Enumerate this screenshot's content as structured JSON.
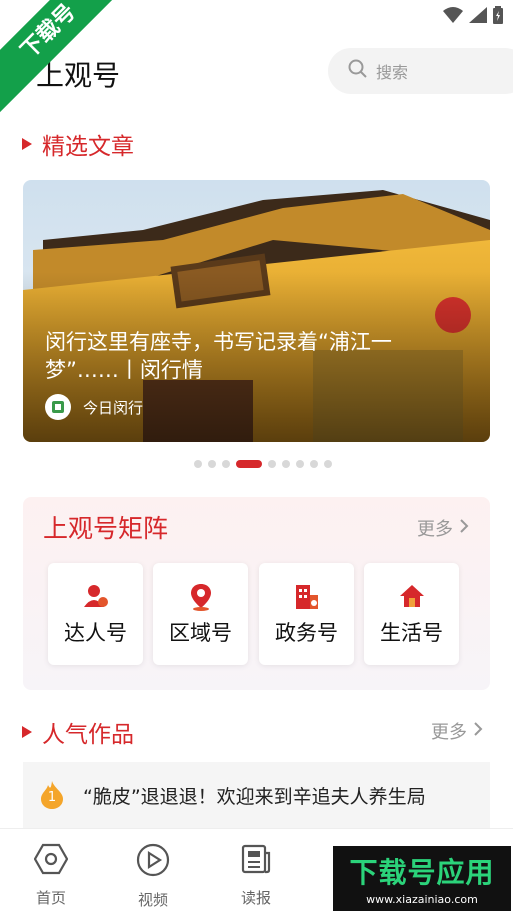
{
  "watermark": {
    "ribbon_text": "下载号",
    "brand_text": "下载号应用",
    "brand_url": "www.xiazainiao.com"
  },
  "header": {
    "title": "上观号"
  },
  "search": {
    "placeholder": "搜索"
  },
  "featured": {
    "section_title": "精选文章",
    "article_title": "闵行这里有座寺，书写记录着“浦江一梦”……丨闵行情",
    "source": "今日闵行",
    "carousel_total": 9,
    "carousel_active_index": 3
  },
  "matrix": {
    "title": "上观号矩阵",
    "more": "更多",
    "items": [
      {
        "label": "达人号",
        "icon": "person-icon"
      },
      {
        "label": "区域号",
        "icon": "location-pin-icon"
      },
      {
        "label": "政务号",
        "icon": "building-icon"
      },
      {
        "label": "生活号",
        "icon": "house-icon"
      }
    ]
  },
  "popular": {
    "section_title": "人气作品",
    "more": "更多",
    "items": [
      {
        "rank": "1",
        "title": "“脆皮”退退退！欢迎来到辛追夫人养生局"
      }
    ]
  },
  "tabbar": {
    "items": [
      {
        "label": "首页",
        "icon": "home-hexagon-icon"
      },
      {
        "label": "视频",
        "icon": "video-play-icon"
      },
      {
        "label": "读报",
        "icon": "newspaper-icon"
      }
    ]
  },
  "colors": {
    "accent": "#d6282b",
    "watermark_green": "#13a04a"
  }
}
